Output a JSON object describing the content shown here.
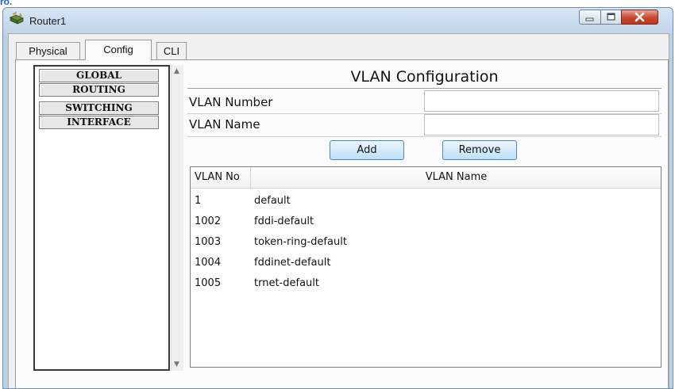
{
  "window": {
    "title": "Router1",
    "top_fragment": "ro."
  },
  "tabs": [
    {
      "label": "Physical"
    },
    {
      "label": "Config"
    },
    {
      "label": "CLI"
    }
  ],
  "sidebar": {
    "items": [
      {
        "label": "GLOBAL"
      },
      {
        "label": "ROUTING"
      },
      {
        "label": "SWITCHING"
      },
      {
        "label": "INTERFACE"
      }
    ]
  },
  "vlan_config": {
    "heading": "VLAN Configuration",
    "number_label": "VLAN Number",
    "number_value": "",
    "name_label": "VLAN Name",
    "name_value": "",
    "add_label": "Add",
    "remove_label": "Remove"
  },
  "vlan_table": {
    "columns": [
      "VLAN No",
      "VLAN Name"
    ],
    "rows": [
      {
        "no": "1",
        "name": "default"
      },
      {
        "no": "1002",
        "name": "fddi-default"
      },
      {
        "no": "1003",
        "name": "token-ring-default"
      },
      {
        "no": "1004",
        "name": "fddinet-default"
      },
      {
        "no": "1005",
        "name": "trnet-default"
      }
    ]
  },
  "colors": {
    "title_bar": "#bfd3ea",
    "close_button": "#c94630",
    "button_border": "#4d86c6",
    "top_label": "#1c64c8"
  },
  "icons": [
    "router-app-icon",
    "minimize-icon",
    "maximize-icon",
    "close-icon",
    "scroll-up-icon",
    "scroll-down-icon"
  ]
}
